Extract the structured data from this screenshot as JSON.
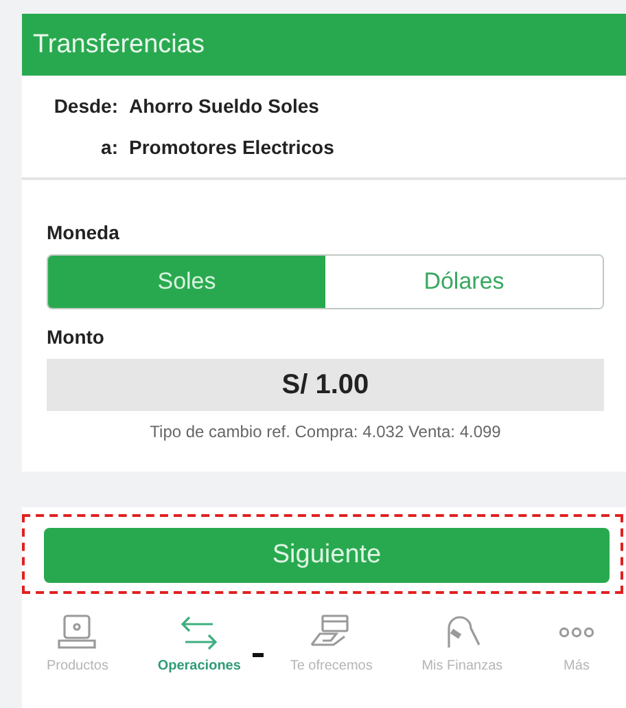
{
  "header": {
    "title": "Transferencias"
  },
  "transfer": {
    "from_label": "Desde:",
    "from_value": "Ahorro Sueldo Soles",
    "to_label": "a:",
    "to_value": "Promotores Electricos"
  },
  "currency": {
    "label": "Moneda",
    "options": [
      {
        "label": "Soles",
        "selected": true
      },
      {
        "label": "Dólares",
        "selected": false
      }
    ]
  },
  "amount": {
    "label": "Monto",
    "value": "S/ 1.00",
    "exchange_note": "Tipo de cambio ref. Compra: 4.032 Venta: 4.099"
  },
  "next_button": {
    "label": "Siguiente",
    "highlighted": true
  },
  "bottom_nav": [
    {
      "kind": "products",
      "label": "Productos",
      "selected": false
    },
    {
      "kind": "operations",
      "label": "Operaciones",
      "selected": true
    },
    {
      "kind": "card",
      "label": "Te ofrecemos",
      "selected": false
    },
    {
      "kind": "finance",
      "label": "Mis Finanzas",
      "selected": false
    },
    {
      "kind": "more",
      "label": "Más",
      "selected": false
    }
  ]
}
